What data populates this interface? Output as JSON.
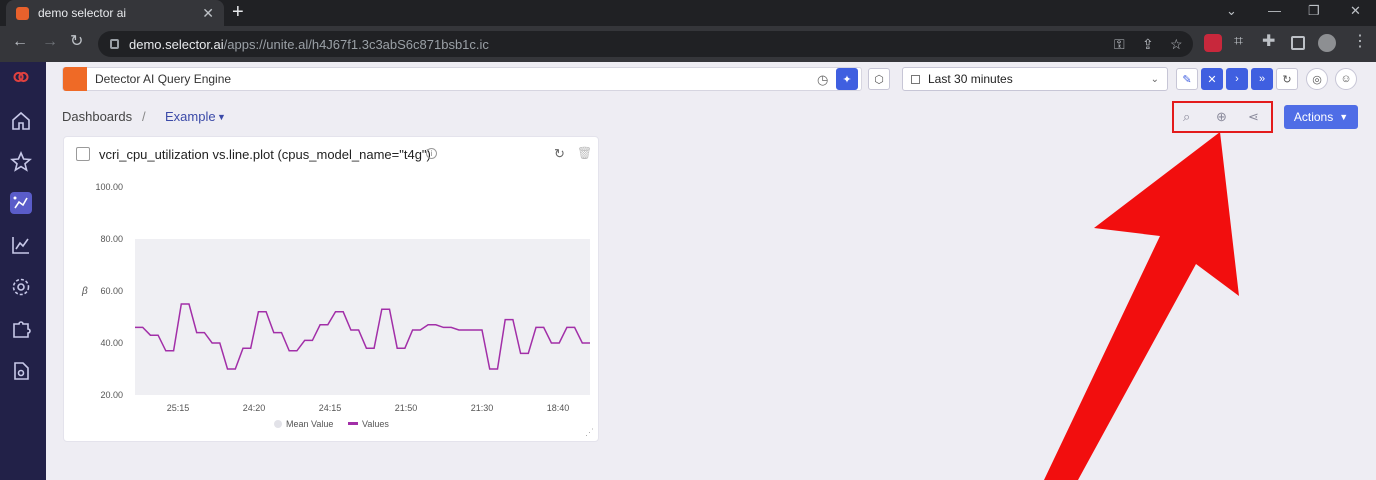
{
  "browser": {
    "tab_title": "demo selector ai",
    "tab_close": "✕",
    "new_tab": "+",
    "url_host": "demo.selector.ai",
    "url_path": "/apps://unite.al/h4J67f1.3c3abS6c871bsb1c.ic"
  },
  "header": {
    "query_title": "Detector AI Query Engine",
    "time_range": "Last 30 minutes"
  },
  "breadcrumb": {
    "root": "Dashboards",
    "separator": "/",
    "current": "Example"
  },
  "toolbar": {
    "actions_label": "Actions"
  },
  "panel": {
    "title": "vcri_cpu_utilization vs.line.plot (cpus_model_name=\"t4g\")",
    "ylabel": "β"
  },
  "chart_data": {
    "type": "line",
    "ylim": [
      20,
      100
    ],
    "yticks": [
      "100.00",
      "80.00",
      "60.00",
      "40.00",
      "20.00"
    ],
    "xticks": [
      "25:15",
      "24:20",
      "24:15",
      "21:50",
      "21:30",
      "18:40"
    ],
    "legend": [
      "Mean Value",
      "Values"
    ],
    "legend_placement": "bottom",
    "colors": {
      "values": "#a22fa8",
      "mean": "#e2e2e8",
      "plot_bg": "#efeff3"
    },
    "series": [
      {
        "name": "Values",
        "values": [
          46,
          46,
          43,
          43,
          37,
          37,
          55,
          55,
          44,
          44,
          40,
          40,
          30,
          30,
          38,
          38,
          52,
          52,
          44,
          44,
          37,
          37,
          41,
          41,
          47,
          47,
          52,
          52,
          45,
          45,
          38,
          38,
          53,
          53,
          38,
          38,
          45,
          45,
          47,
          47,
          46,
          46,
          45,
          45,
          45,
          45,
          30,
          30,
          49,
          49,
          36,
          36,
          46,
          46,
          40,
          40,
          46,
          46,
          40,
          40
        ]
      }
    ]
  }
}
